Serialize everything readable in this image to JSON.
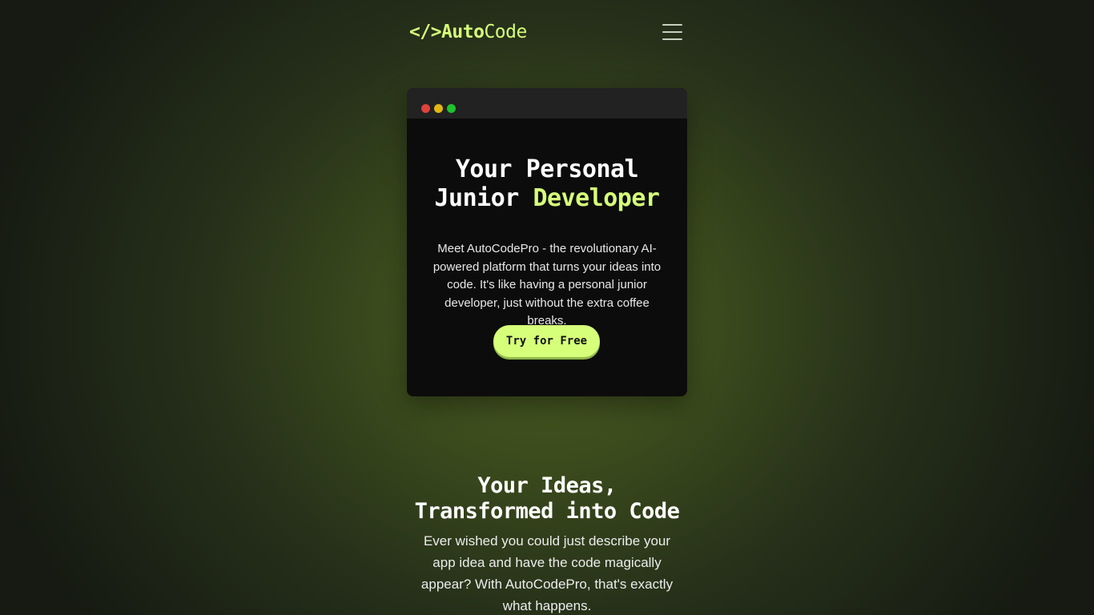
{
  "nav": {
    "logo_bracket": "</>",
    "logo_auto": "Auto",
    "logo_code": "Code",
    "menu_icon": "hamburger-menu-icon"
  },
  "hero": {
    "title_line1": "Your Personal",
    "title_line2_prefix": "Junior ",
    "title_line2_accent": "Developer",
    "description": "Meet AutoCodePro - the revolutionary AI-powered platform that turns your ideas into code. It's like having a personal junior developer, just without the extra coffee breaks.",
    "cta_label": "Try for Free"
  },
  "section2": {
    "title_line1": "Your Ideas,",
    "title_line2": "Transformed into Code",
    "description": "Ever wished you could just describe your app idea and have the code magically appear? With AutoCodePro, that's exactly what happens."
  },
  "colors": {
    "accent": "#d6ff7a",
    "card_bg": "#0c0c0c",
    "window_dot_red": "#e0413b",
    "window_dot_yellow": "#e2b714",
    "window_dot_green": "#1fc32c"
  }
}
